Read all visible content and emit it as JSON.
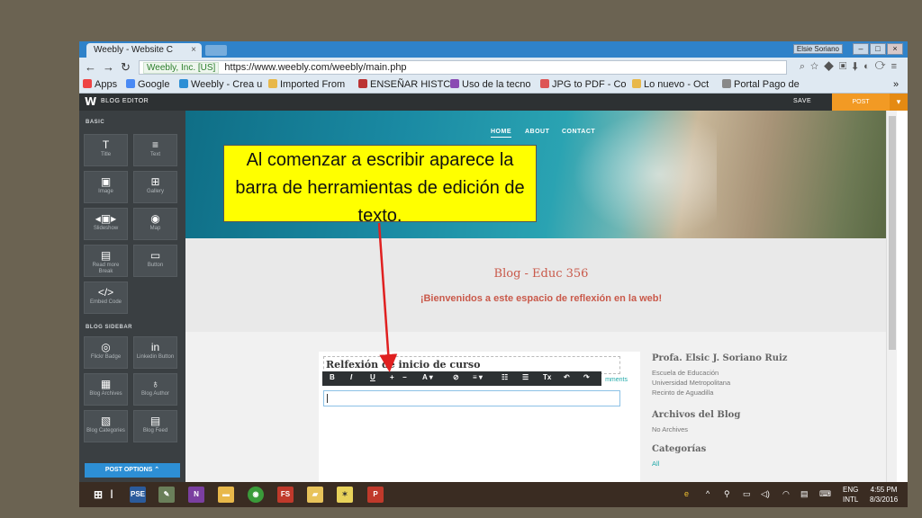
{
  "browser": {
    "tab_title": "Weebly - Website C",
    "tab_close": "×",
    "user_badge": "Elsie Soriano",
    "secure_label": "Weebly, Inc. [US]",
    "url": "https://www.weebly.com/weebly/main.php",
    "bookmarks": [
      {
        "label": "Apps",
        "color": "#e44"
      },
      {
        "label": "Google",
        "color": "#4a8af4"
      },
      {
        "label": "Weebly - Crea u",
        "color": "#2d8fd5"
      },
      {
        "label": "Imported From",
        "color": "#e8b84a"
      },
      {
        "label": "ENSEÑAR HISTC",
        "color": "#b33"
      },
      {
        "label": "Uso de la tecno",
        "color": "#8a4ab3"
      },
      {
        "label": "JPG to PDF - Co",
        "color": "#d55"
      },
      {
        "label": "Lo nuevo - Oct",
        "color": "#e8b84a"
      },
      {
        "label": "Portal Pago de",
        "color": "#888"
      }
    ],
    "more": "»"
  },
  "weebly": {
    "logo": "W",
    "title": "BLOG EDITOR",
    "save": "SAVE",
    "post": "POST",
    "post_arrow": "▾"
  },
  "sidebar": {
    "basic_label": "BASIC",
    "basic_items": [
      {
        "icon": "T",
        "label": "Title"
      },
      {
        "icon": "≡",
        "label": "Text"
      },
      {
        "icon": "▣",
        "label": "Image"
      },
      {
        "icon": "⊞",
        "label": "Gallery"
      },
      {
        "icon": "◂▣▸",
        "label": "Slideshow"
      },
      {
        "icon": "◉",
        "label": "Map"
      },
      {
        "icon": "▤",
        "label": "Read more Break"
      },
      {
        "icon": "▭",
        "label": "Button"
      },
      {
        "icon": "</>",
        "label": "Embed Code"
      }
    ],
    "blog_label": "BLOG SIDEBAR",
    "blog_items": [
      {
        "icon": "◎",
        "label": "Flickr Badge"
      },
      {
        "icon": "in",
        "label": "Linkedin Button"
      },
      {
        "icon": "▦",
        "label": "Blog Archives"
      },
      {
        "icon": "♁",
        "label": "Blog Author"
      },
      {
        "icon": "▧",
        "label": "Blog Categories"
      },
      {
        "icon": "▤",
        "label": "Blog Feed"
      }
    ],
    "post_options": "POST OPTIONS ⌃"
  },
  "site": {
    "menu": [
      "HOME",
      "ABOUT",
      "CONTACT"
    ],
    "blog_title": "Blog - Educ 356",
    "subtitle": "¡Bienvenidos a este espacio de reflexión en la web!",
    "post_title": "Relfexión de inicio de curso",
    "comments": "mments",
    "toolbar": [
      "B",
      "I",
      "U",
      "+",
      "−",
      "A ▾",
      "⊘",
      "≡ ▾",
      "☷",
      "☰",
      "Tx",
      "↶",
      "↷"
    ]
  },
  "right_column": {
    "author": "Profa. Elsic J. Soriano Ruiz",
    "author_lines": [
      "Escuela de Educación",
      "Universidad Metropolitana",
      "Recinto de Aguadilla"
    ],
    "archives_title": "Archivos del Blog",
    "archives_text": "No Archives",
    "categories_title": "Categorías",
    "categories_text": "All"
  },
  "callout": {
    "text": "Al comenzar a escribir aparece la barra de herramientas de edición de texto."
  },
  "taskbar": {
    "apps": [
      {
        "label": "PSE",
        "color": "#2b5b9c"
      },
      {
        "label": "✎",
        "color": "#6a7f5a"
      },
      {
        "label": "N",
        "color": "#7b3fa0"
      },
      {
        "label": "▬",
        "color": "#e8b84a"
      },
      {
        "label": "◉",
        "color": "#3a9b3a"
      },
      {
        "label": "FS",
        "color": "#c0392b"
      },
      {
        "label": "▰",
        "color": "#e8c35a"
      },
      {
        "label": "✶",
        "color": "#e8d25a"
      },
      {
        "label": "P",
        "color": "#c0392b"
      }
    ],
    "lang_top": "ENG",
    "lang_bottom": "INTL",
    "time": "4:55 PM",
    "date": "8/3/2016"
  }
}
